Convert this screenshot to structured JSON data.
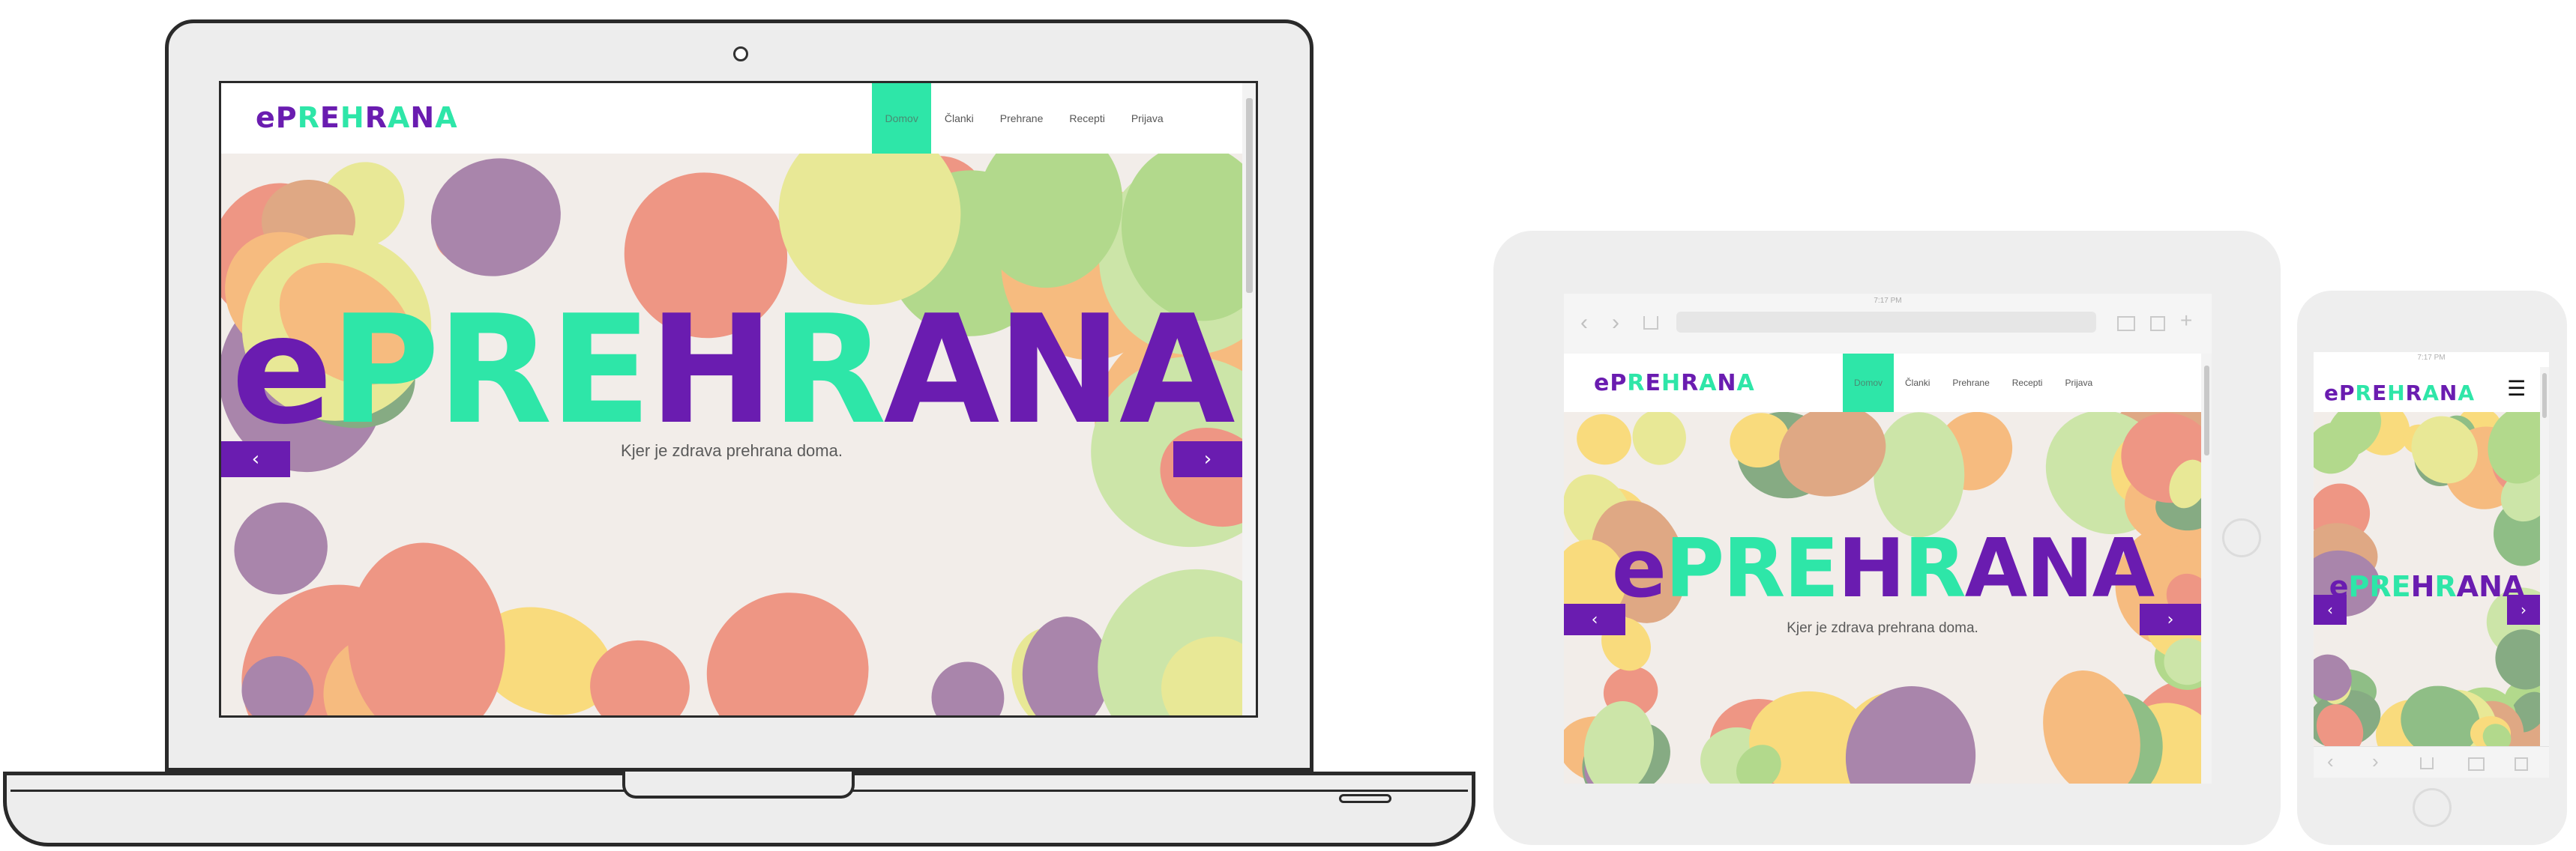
{
  "brand": {
    "parts": [
      {
        "text": "e",
        "tone": "purple"
      },
      {
        "text": "P",
        "tone": "purple"
      },
      {
        "text": "R",
        "tone": "mint"
      },
      {
        "text": "E",
        "tone": "purple"
      },
      {
        "text": "H",
        "tone": "mint"
      },
      {
        "text": "R",
        "tone": "purple"
      },
      {
        "text": "A",
        "tone": "mint"
      },
      {
        "text": "N",
        "tone": "purple"
      },
      {
        "text": "A",
        "tone": "mint"
      }
    ]
  },
  "hero_title": {
    "parts": [
      {
        "text": "e",
        "tone": "purple"
      },
      {
        "text": "P",
        "tone": "mint"
      },
      {
        "text": "R",
        "tone": "mint"
      },
      {
        "text": "E",
        "tone": "mint"
      },
      {
        "text": "H",
        "tone": "purple"
      },
      {
        "text": "R",
        "tone": "mint"
      },
      {
        "text": "A",
        "tone": "purple"
      },
      {
        "text": "N",
        "tone": "purple"
      },
      {
        "text": "A",
        "tone": "purple"
      }
    ]
  },
  "nav": {
    "items": [
      {
        "label": "Domov",
        "active": true
      },
      {
        "label": "Članki",
        "active": false
      },
      {
        "label": "Prehrane",
        "active": false
      },
      {
        "label": "Recepti",
        "active": false
      },
      {
        "label": "Prijava",
        "active": false
      }
    ]
  },
  "hero": {
    "subtitle": "Kjer je zdrava prehrana doma.",
    "prev_icon": "‹",
    "next_icon": "›"
  },
  "tablet_status": {
    "time": "7:17 PM"
  },
  "phone_status": {
    "time": "7:17 PM"
  },
  "mobile_menu_icon": "☰",
  "colors": {
    "purple": "#6a1cb0",
    "mint": "#2ee6a8",
    "active_nav_bg": "#2ee6a8",
    "carousel_button": "#6a1cb0",
    "device_frame": "#eeeeee",
    "hero_background": "#e8e1da"
  },
  "icons": {
    "webcam": "webcam-icon",
    "back": "chevron-left-icon",
    "forward": "chevron-right-icon",
    "share": "share-icon",
    "bookmarks": "book-icon",
    "tabs": "tabs-icon",
    "new_tab": "plus-icon",
    "home_button": "home-button-icon",
    "hamburger": "hamburger-icon"
  }
}
